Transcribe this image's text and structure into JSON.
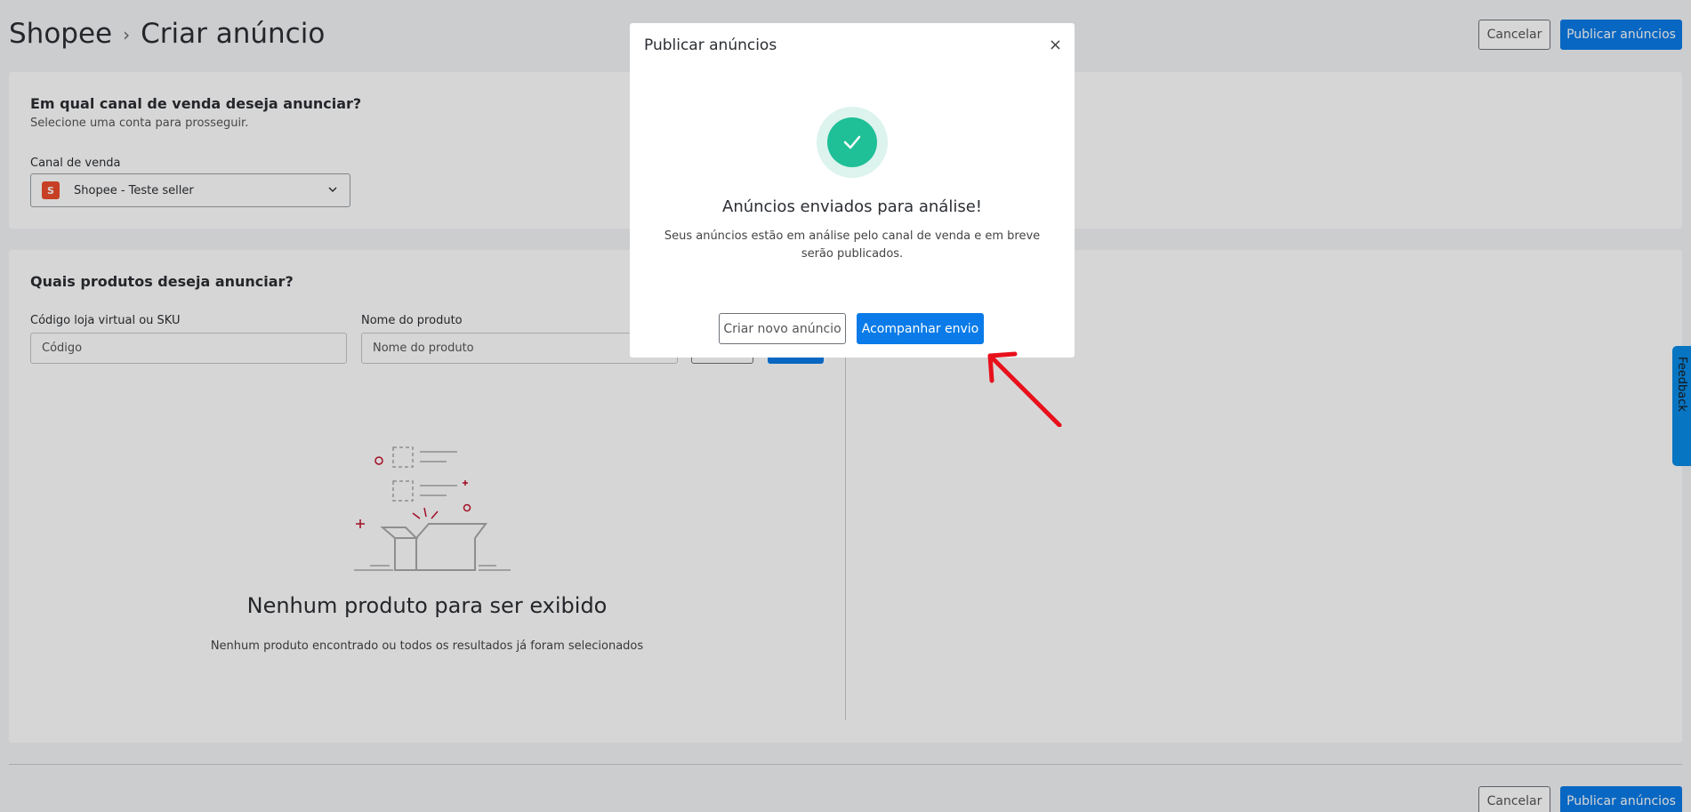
{
  "header": {
    "breadcrumb": [
      "Shopee",
      "Criar anúncio"
    ],
    "separator": "›",
    "cancel_label": "Cancelar",
    "publish_label": "Publicar anúncios"
  },
  "channel_section": {
    "title": "Em qual canal de venda deseja anunciar?",
    "subtitle": "Selecione uma conta para prosseguir.",
    "field_label": "Canal de venda",
    "selected_value": "Shopee - Teste seller"
  },
  "products_section": {
    "title": "Quais produtos deseja anunciar?",
    "sku_label": "Código loja virtual ou SKU",
    "sku_placeholder": "Código",
    "name_label": "Nome do produto",
    "name_placeholder": "Nome do produto",
    "empty_title": "Nenhum produto para ser exibido",
    "empty_subtitle": "Nenhum produto encontrado ou todos os resultados já foram selecionados"
  },
  "footer": {
    "cancel_label": "Cancelar",
    "publish_label": "Publicar anúncios"
  },
  "feedback_tab": {
    "label": "Feedback"
  },
  "modal": {
    "title": "Publicar anúncios",
    "close_symbol": "×",
    "heading": "Anúncios enviados para análise!",
    "text": "Seus anúncios estão em análise pelo canal de venda e em breve serão publicados.",
    "new_ad_label": "Criar novo anúncio",
    "follow_label": "Acompanhar envio"
  },
  "colors": {
    "primary": "#0a7be8",
    "success": "#1fbf97",
    "shopee": "#ee4d2d",
    "annotation_arrow": "#e8101b"
  }
}
